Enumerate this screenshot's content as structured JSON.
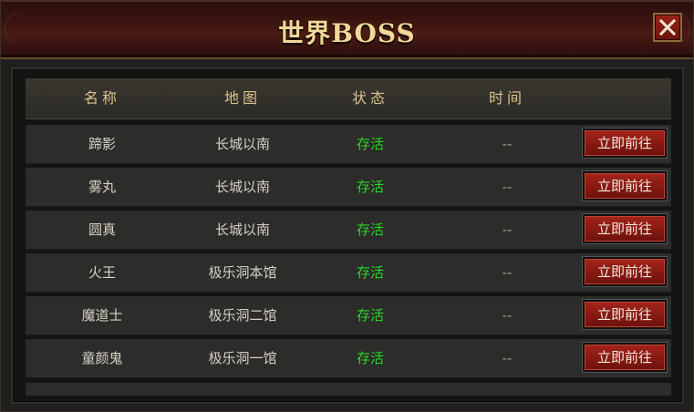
{
  "window": {
    "title": "世界BOSS"
  },
  "table": {
    "headers": {
      "name": "名称",
      "map": "地图",
      "status": "状态",
      "time": "时间"
    },
    "rows": [
      {
        "name": "蹄影",
        "map": "长城以南",
        "status": "存活",
        "time": "--",
        "action": "立即前往"
      },
      {
        "name": "雾丸",
        "map": "长城以南",
        "status": "存活",
        "time": "--",
        "action": "立即前往"
      },
      {
        "name": "圆真",
        "map": "长城以南",
        "status": "存活",
        "time": "--",
        "action": "立即前往"
      },
      {
        "name": "火王",
        "map": "极乐洞本馆",
        "status": "存活",
        "time": "--",
        "action": "立即前往"
      },
      {
        "name": "魔道士",
        "map": "极乐洞二馆",
        "status": "存活",
        "time": "--",
        "action": "立即前往"
      },
      {
        "name": "童颜鬼",
        "map": "极乐洞一馆",
        "status": "存活",
        "time": "--",
        "action": "立即前往"
      }
    ]
  },
  "colors": {
    "status_alive": "#2bd42b",
    "title_gold": "#f3d79a",
    "button_red": "#a4241b"
  }
}
